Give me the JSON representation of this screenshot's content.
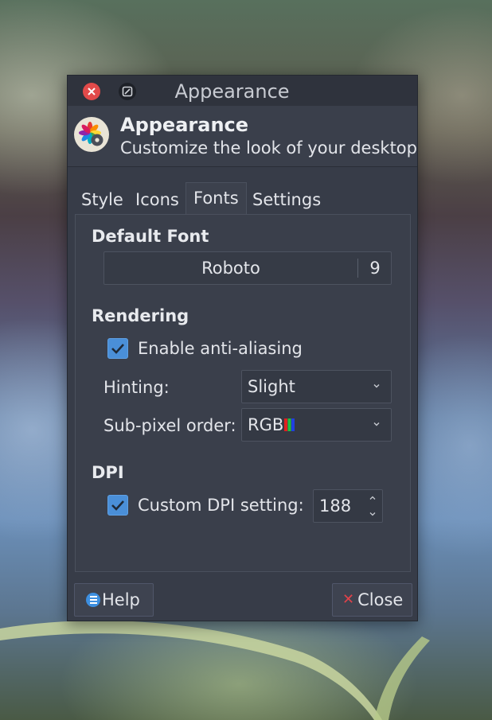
{
  "window": {
    "title": "Appearance"
  },
  "header": {
    "title": "Appearance",
    "subtitle": "Customize the look of your desktop"
  },
  "tabs": [
    {
      "label": "Style"
    },
    {
      "label": "Icons"
    },
    {
      "label": "Fonts",
      "active": true
    },
    {
      "label": "Settings"
    }
  ],
  "fonts": {
    "default_font_heading": "Default Font",
    "font_name": "Roboto",
    "font_size": "9",
    "rendering_heading": "Rendering",
    "antialias_label": "Enable anti-aliasing",
    "antialias_checked": true,
    "hinting_label": "Hinting:",
    "hinting_value": "Slight",
    "subpixel_label": "Sub-pixel order:",
    "subpixel_value": "RGB",
    "dpi_heading": "DPI",
    "custom_dpi_label": "Custom DPI setting:",
    "custom_dpi_checked": true,
    "dpi_value": "188"
  },
  "footer": {
    "help_label": "Help",
    "close_label": "Close"
  },
  "colors": {
    "window_bg": "#373c48",
    "accent": "#4a8fd8",
    "close_red": "#e24a4a"
  },
  "icons": {
    "titlebar_close": "close-icon",
    "titlebar_maximize": "maximize-icon",
    "app": "color-wheel-gear-icon",
    "combo_arrow": "chevron-down-icon",
    "help": "help-icon",
    "close": "close-x-icon"
  }
}
